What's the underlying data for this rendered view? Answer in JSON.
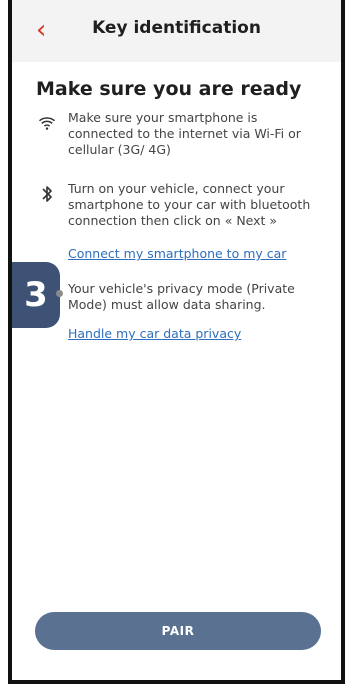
{
  "header": {
    "title": "Key identification",
    "back_icon": "chevron-left-icon"
  },
  "main": {
    "heading": "Make sure you are ready",
    "items": [
      {
        "icon": "wifi-icon",
        "text": "Make sure your smartphone is connected to the internet via Wi-Fi or cellular (3G/ 4G)"
      },
      {
        "icon": "bluetooth-icon",
        "text": "Turn on your vehicle, connect your smartphone to your car with bluetooth connection then click on « Next »",
        "link": "Connect my smartphone to my car"
      },
      {
        "icon": "privacy-dot",
        "text": "Your vehicle's privacy mode (Private Mode) must allow data sharing.",
        "link": "Handle my car data privacy"
      }
    ],
    "step_badge": "3",
    "primary_button": "PAIR"
  },
  "colors": {
    "accent": "#d9342b",
    "link": "#2f6fbd",
    "button": "#5a7191",
    "badge": "#3d5275"
  }
}
